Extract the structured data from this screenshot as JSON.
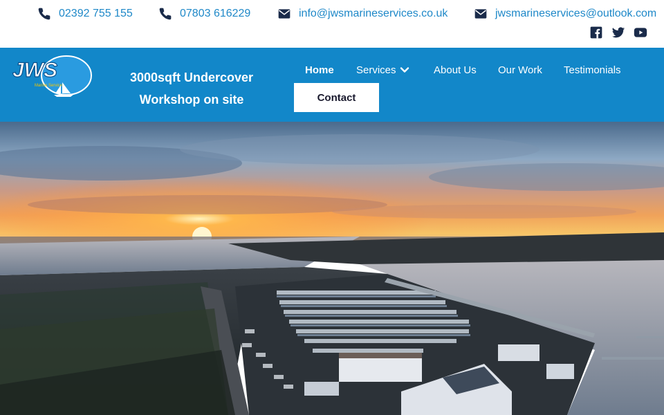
{
  "contacts": [
    {
      "icon": "phone-icon",
      "text": "02392 755 155"
    },
    {
      "icon": "phone-icon",
      "text": "07803 616229"
    },
    {
      "icon": "envelope-icon",
      "text": "info@jwsmarineservices.co.uk"
    },
    {
      "icon": "envelope-icon",
      "text": "jwsmarineservices@outlook.com"
    }
  ],
  "social": [
    "facebook-icon",
    "twitter-icon",
    "youtube-icon"
  ],
  "logo": {
    "text": "JWS",
    "subtext": "Marine Services"
  },
  "tagline": "3000sqft Undercover Workshop on site",
  "nav": {
    "home": "Home",
    "services": "Services",
    "about": "About Us",
    "work": "Our Work",
    "testimonials": "Testimonials",
    "contact": "Contact"
  },
  "colors": {
    "brand_blue": "#1287c9",
    "link_blue": "#1e88c8",
    "icon_dark": "#1a2b4a"
  },
  "hero": {
    "icon": "marina-sunset-aerial-image"
  }
}
